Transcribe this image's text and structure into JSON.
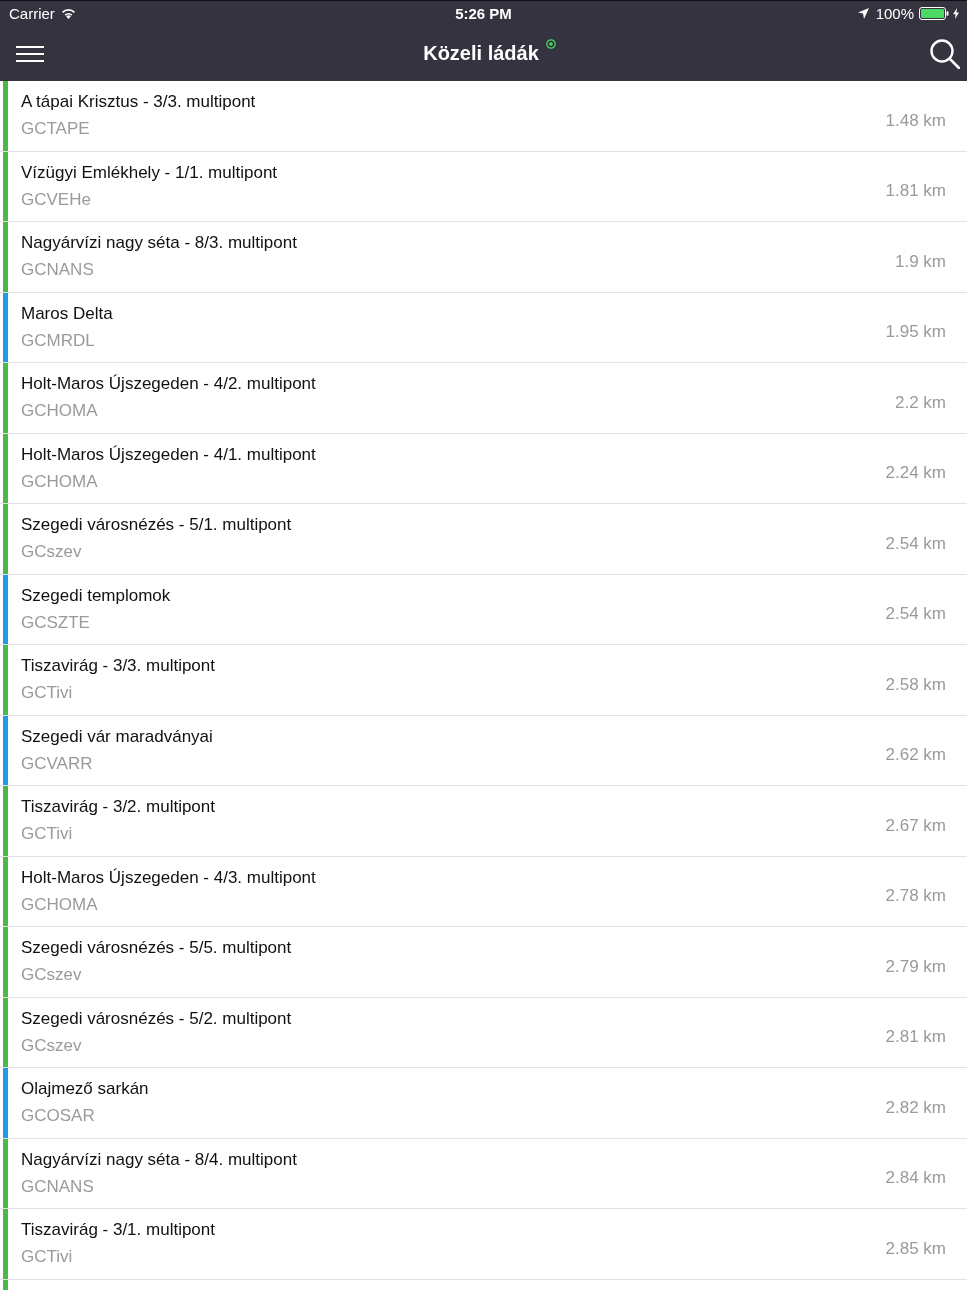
{
  "status_bar": {
    "carrier": "Carrier",
    "time": "5:26 PM",
    "battery": "100%"
  },
  "nav_bar": {
    "title": "Közeli ládák"
  },
  "caches": [
    {
      "name": "A tápai Krisztus - 3/3. multipont",
      "code": "GCTAPE",
      "distance": "1.48 km",
      "color": "#4cb84c"
    },
    {
      "name": "Vízügyi Emlékhely - 1/1. multipont",
      "code": "GCVEHe",
      "distance": "1.81 km",
      "color": "#4cb84c"
    },
    {
      "name": "Nagyárvízi nagy séta - 8/3. multipont",
      "code": "GCNANS",
      "distance": "1.9 km",
      "color": "#4cb84c"
    },
    {
      "name": "Maros Delta",
      "code": "GCMRDL",
      "distance": "1.95 km",
      "color": "#1e9de6"
    },
    {
      "name": "Holt-Maros Újszegeden - 4/2. multipont",
      "code": "GCHOMA",
      "distance": "2.2 km",
      "color": "#4cb84c"
    },
    {
      "name": "Holt-Maros Újszegeden - 4/1. multipont",
      "code": "GCHOMA",
      "distance": "2.24 km",
      "color": "#4cb84c"
    },
    {
      "name": "Szegedi városnézés - 5/1. multipont",
      "code": "GCszev",
      "distance": "2.54 km",
      "color": "#4cb84c"
    },
    {
      "name": "Szegedi templomok",
      "code": "GCSZTE",
      "distance": "2.54 km",
      "color": "#1e9de6"
    },
    {
      "name": "Tiszavirág - 3/3. multipont",
      "code": "GCTivi",
      "distance": "2.58 km",
      "color": "#4cb84c"
    },
    {
      "name": "Szegedi vár maradványai",
      "code": "GCVARR",
      "distance": "2.62 km",
      "color": "#1e9de6"
    },
    {
      "name": "Tiszavirág - 3/2. multipont",
      "code": "GCTivi",
      "distance": "2.67 km",
      "color": "#4cb84c"
    },
    {
      "name": "Holt-Maros Újszegeden - 4/3. multipont",
      "code": "GCHOMA",
      "distance": "2.78 km",
      "color": "#4cb84c"
    },
    {
      "name": "Szegedi városnézés - 5/5. multipont",
      "code": "GCszev",
      "distance": "2.79 km",
      "color": "#4cb84c"
    },
    {
      "name": "Szegedi városnézés - 5/2. multipont",
      "code": "GCszev",
      "distance": "2.81 km",
      "color": "#4cb84c"
    },
    {
      "name": "Olajmező sarkán",
      "code": "GCOSAR",
      "distance": "2.82 km",
      "color": "#1e9de6"
    },
    {
      "name": "Nagyárvízi nagy séta - 8/4. multipont",
      "code": "GCNANS",
      "distance": "2.84 km",
      "color": "#4cb84c"
    },
    {
      "name": "Tiszavirág - 3/1. multipont",
      "code": "GCTivi",
      "distance": "2.85 km",
      "color": "#4cb84c"
    },
    {
      "color": "#4cb84c"
    }
  ]
}
